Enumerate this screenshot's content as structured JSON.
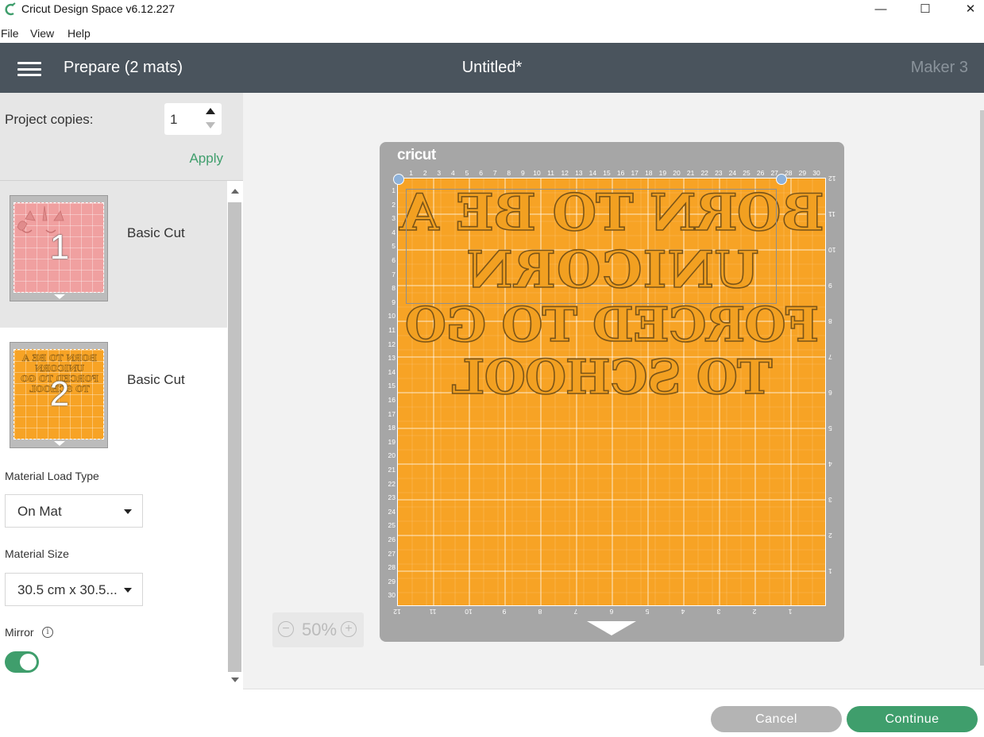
{
  "window": {
    "title": "Cricut Design Space  v6.12.227",
    "controls": {
      "minimize": "—",
      "maximize": "☐",
      "close": "✕"
    }
  },
  "menu": [
    "File",
    "View",
    "Help"
  ],
  "header": {
    "menu_icon": "hamburger-menu-icon",
    "title": "Prepare (2 mats)",
    "document": "Untitled*",
    "machine": "Maker 3"
  },
  "left_panel": {
    "project_copies_label": "Project copies:",
    "project_copies_value": "1",
    "apply_label": "Apply",
    "mats": [
      {
        "number": "1",
        "label": "Basic Cut",
        "color": "#f0a0a0",
        "selected": true
      },
      {
        "number": "2",
        "label": "Basic Cut",
        "color": "#f7a325",
        "selected": false
      }
    ],
    "material_load_type_label": "Material Load Type",
    "material_load_type_value": "On Mat",
    "material_size_label": "Material Size",
    "material_size_value": "30.5 cm x 30.5...",
    "mirror_label": "Mirror",
    "mirror_info_icon": "i",
    "mirror_on": true
  },
  "canvas": {
    "brand": "cricut",
    "mat_color": "#f7a325",
    "design_lines": [
      "BORN TO BE A",
      "UNICORN",
      "FORCED TO GO",
      "TO   SCHOOL"
    ],
    "ruler_top": [
      "1",
      "2",
      "3",
      "4",
      "5",
      "6",
      "7",
      "8",
      "9",
      "10",
      "11",
      "12",
      "13",
      "14",
      "15",
      "16",
      "17",
      "18",
      "19",
      "20",
      "21",
      "22",
      "23",
      "24",
      "25",
      "26",
      "27",
      "28",
      "29",
      "30"
    ],
    "ruler_left": [
      "1",
      "2",
      "3",
      "4",
      "5",
      "6",
      "7",
      "8",
      "9",
      "10",
      "11",
      "12",
      "13",
      "14",
      "15",
      "16",
      "17",
      "18",
      "19",
      "20",
      "21",
      "22",
      "23",
      "24",
      "25",
      "26",
      "27",
      "28",
      "29",
      "30"
    ],
    "ruler_right": [
      "12",
      "11",
      "10",
      "9",
      "8",
      "7",
      "6",
      "5",
      "4",
      "3",
      "2",
      "1"
    ],
    "ruler_bottom": [
      "12",
      "11",
      "10",
      "9",
      "8",
      "7",
      "6",
      "5",
      "4",
      "3",
      "2",
      "1"
    ],
    "zoom": {
      "minus": "−",
      "value": "50%",
      "plus": "+"
    }
  },
  "footer": {
    "cancel": "Cancel",
    "continue": "Continue"
  }
}
